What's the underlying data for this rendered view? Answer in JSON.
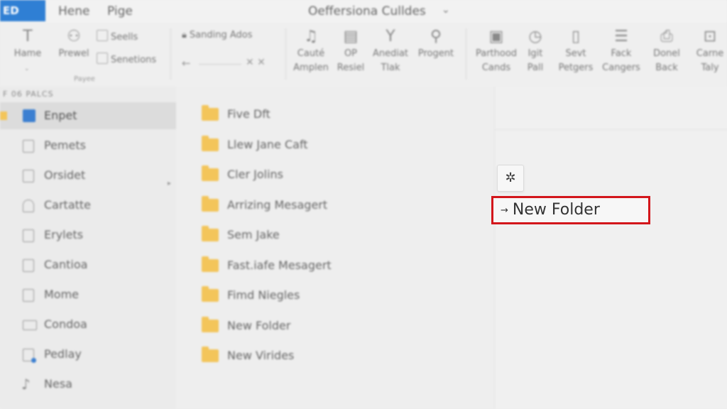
{
  "topbar": {
    "app_badge": "ED",
    "tabs": [
      "Hene",
      "Pige"
    ],
    "window_title": "Oeffersiona Culldes",
    "title_chevron": "⌄"
  },
  "ribbon": {
    "home": {
      "label": "Hame",
      "sub": "⌄"
    },
    "prewel": "Prewel",
    "small_items": [
      "Seells",
      "Senetions"
    ],
    "group_label": "Payee",
    "sanding": "Sanding Ados",
    "nav_arrow": "←",
    "nav_x": "✕ ✕",
    "buttons": [
      {
        "label": "Cauté\nAmplen",
        "icon": "music-note-icon"
      },
      {
        "label": "OP\nResiel",
        "icon": "document-icon"
      },
      {
        "label": "Anediat\nTlak",
        "icon": "filter-icon"
      },
      {
        "label": "Progent",
        "icon": "search-folder-icon"
      },
      {
        "label": "Parthood\nCands",
        "icon": "cards-icon"
      },
      {
        "label": "Igit\nPall",
        "icon": "clock-icon"
      },
      {
        "label": "Sevt\nPetgers",
        "icon": "page-icon"
      },
      {
        "label": "Fack\nCangers",
        "icon": "stack-icon"
      },
      {
        "label": "Donel\nBack",
        "icon": "printer-icon"
      },
      {
        "label": "Carne\nTaly",
        "icon": "lock-icon"
      }
    ]
  },
  "sidebar": {
    "header": "F 06 PALCS",
    "items": [
      {
        "label": "Enpet",
        "selected": true
      },
      {
        "label": "Pemets"
      },
      {
        "label": "Orsidet"
      },
      {
        "label": "Cartatte"
      },
      {
        "label": "Erylets"
      },
      {
        "label": "Cantioa"
      },
      {
        "label": "Mome"
      },
      {
        "label": "Condoa"
      },
      {
        "label": "Pedlay"
      },
      {
        "label": "Nesa"
      }
    ]
  },
  "files": [
    {
      "name": "Five Dft"
    },
    {
      "name": "Llew Jane Caft"
    },
    {
      "name": "Cler Jolins"
    },
    {
      "name": "Arrizing Mesagert"
    },
    {
      "name": "Sem Jake"
    },
    {
      "name": "Fast.iafe Mesagert"
    },
    {
      "name": "Fimd Niegles"
    },
    {
      "name": "New Folder"
    },
    {
      "name": "New Virides"
    }
  ],
  "context": {
    "star": "✲",
    "item_arrow": "→",
    "item_label": "New Folder",
    "highlight_color": "#d3161b"
  }
}
